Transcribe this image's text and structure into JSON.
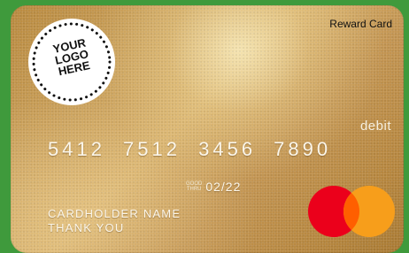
{
  "card": {
    "logo_lines": [
      "YOUR",
      "LOGO",
      "HERE"
    ],
    "card_type": "Reward Card",
    "debit_label": "debit",
    "number": "5412  7512  3456  7890",
    "valid_thru_lines": [
      "GOOD",
      "THRU"
    ],
    "expiry": "02/22",
    "cardholder_lines": [
      "CARDHOLDER NAME",
      "THANK YOU"
    ],
    "network_logo": "mastercard-logo",
    "colors": {
      "background": "#3f9a3c",
      "card_gold": "#c39552",
      "mc_red": "#eb001b",
      "mc_orange": "#f79e1b",
      "mc_overlap": "#ff5f00"
    }
  }
}
